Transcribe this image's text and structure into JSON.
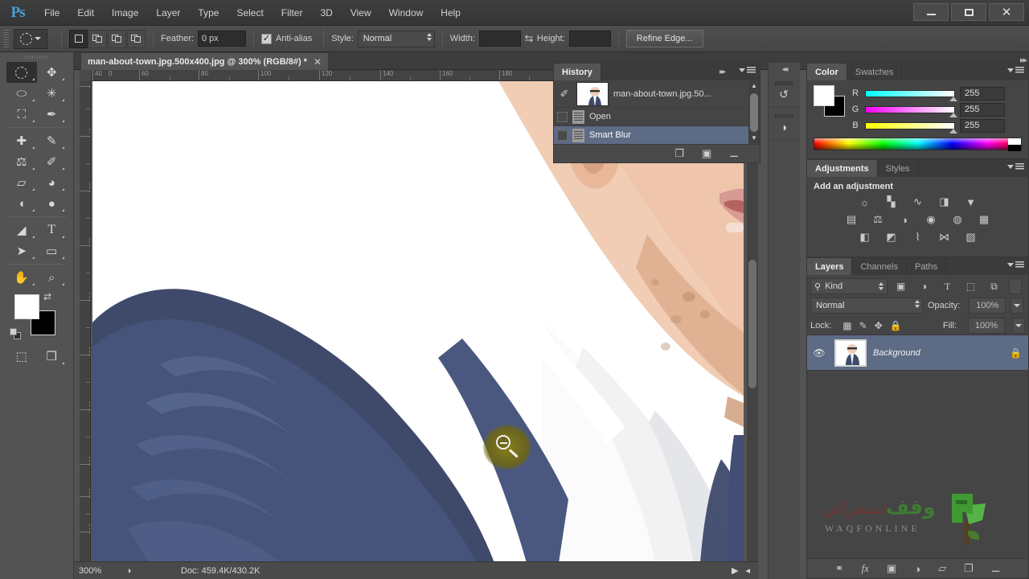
{
  "app": {
    "name": "Ps"
  },
  "menubar": {
    "items": [
      "File",
      "Edit",
      "Image",
      "Layer",
      "Type",
      "Select",
      "Filter",
      "3D",
      "View",
      "Window",
      "Help"
    ],
    "window_controls": {
      "minimize": "minimize-icon",
      "maximize": "maximize-icon",
      "close": "close-icon"
    }
  },
  "options_bar": {
    "tool_preset_icon": "elliptical-marquee-icon",
    "selection_modes": [
      "new-selection",
      "add-to-selection",
      "subtract-from-selection",
      "intersect-with-selection"
    ],
    "feather_label": "Feather:",
    "feather_value": "0 px",
    "antialias_label": "Anti-alias",
    "antialias_checked": true,
    "style_label": "Style:",
    "style_value": "Normal",
    "width_label": "Width:",
    "width_value": "",
    "height_label": "Height:",
    "height_value": "",
    "swap_icon": "swap-width-height-icon",
    "refine_edge_label": "Refine Edge..."
  },
  "toolbar": {
    "tools": [
      {
        "name": "elliptical-marquee-tool",
        "glyph": "◌",
        "active": true
      },
      {
        "name": "move-tool",
        "glyph": "✥",
        "active": false
      },
      {
        "name": "lasso-tool",
        "glyph": "⬭",
        "active": false
      },
      {
        "name": "magic-wand-tool",
        "glyph": "✳",
        "active": false
      },
      {
        "name": "crop-tool",
        "glyph": "⛶",
        "active": false
      },
      {
        "name": "eyedropper-tool",
        "glyph": "✒",
        "active": false
      },
      {
        "name": "spot-healing-brush-tool",
        "glyph": "⊕",
        "active": false
      },
      {
        "name": "brush-tool",
        "glyph": "✎",
        "active": false
      },
      {
        "name": "clone-stamp-tool",
        "glyph": "⚒",
        "active": false
      },
      {
        "name": "history-brush-tool",
        "glyph": "✐",
        "active": false
      },
      {
        "name": "eraser-tool",
        "glyph": "▱",
        "active": false
      },
      {
        "name": "paint-bucket-tool",
        "glyph": "◕",
        "active": false
      },
      {
        "name": "blur-tool",
        "glyph": "◖",
        "active": false
      },
      {
        "name": "dodge-tool",
        "glyph": "●",
        "active": false
      },
      {
        "name": "pen-tool",
        "glyph": "✒",
        "active": false
      },
      {
        "name": "horizontal-type-tool",
        "glyph": "T",
        "active": false
      },
      {
        "name": "path-selection-tool",
        "glyph": "➤",
        "active": false
      },
      {
        "name": "rectangle-tool",
        "glyph": "▭",
        "active": false
      },
      {
        "name": "hand-tool",
        "glyph": "✋",
        "active": false
      },
      {
        "name": "zoom-tool",
        "glyph": "⌕",
        "active": false
      }
    ],
    "foreground_color": "#ffffff",
    "background_color": "#000000",
    "bottom_tools": [
      {
        "name": "quick-mask-mode-button",
        "glyph": "⬚"
      },
      {
        "name": "screen-mode-button",
        "glyph": "❐"
      }
    ]
  },
  "document": {
    "tab_title": "man-about-town.jpg.500x400.jpg @ 300% (RGB/8#) *",
    "tab_close_icon": "close-icon",
    "ruler_h_ticks": [
      "40",
      "0",
      "60",
      "80",
      "100",
      "120",
      "140",
      "160",
      "180"
    ],
    "ruler_v_ticks": [
      "0",
      "140",
      "160",
      "180",
      "200",
      "220",
      "240",
      "260",
      "280",
      "300"
    ],
    "cursor": "zoom-out-cursor"
  },
  "status_bar": {
    "zoom": "300%",
    "preview_icon": "document-preview-icon",
    "doc_info": "Doc: 459.4K/430.2K",
    "play_icon": "play-icon",
    "collapse_icon": "collapse-left-icon"
  },
  "mini_dock": {
    "collapse_icon": "collapse-dock-icon",
    "buttons": [
      {
        "name": "history-actions-dock-button",
        "glyph": "↺"
      },
      {
        "name": "color-swatches-dock-button",
        "glyph": "◑"
      }
    ]
  },
  "history_panel": {
    "tabs": [
      {
        "label": "History",
        "active": true
      }
    ],
    "forward_icon": "fast-forward-icon",
    "menu_icon": "panel-menu-icon",
    "items": [
      {
        "label": "man-about-town.jpg.50...",
        "type": "snapshot",
        "selected": false
      },
      {
        "label": "Open",
        "type": "state",
        "selected": false
      },
      {
        "label": "Smart Blur",
        "type": "state",
        "selected": true
      }
    ],
    "footer_buttons": [
      {
        "name": "create-document-from-state-button",
        "glyph": "❐"
      },
      {
        "name": "create-snapshot-button",
        "glyph": "▣"
      },
      {
        "name": "delete-state-button",
        "glyph": "Ὕ1"
      }
    ]
  },
  "color_panel": {
    "tabs": [
      {
        "label": "Color",
        "active": true
      },
      {
        "label": "Swatches",
        "active": false
      }
    ],
    "menu_icon": "panel-menu-icon",
    "foreground_color": "#ffffff",
    "background_color": "#000000",
    "channels": [
      {
        "label": "R",
        "value": "255"
      },
      {
        "label": "G",
        "value": "255"
      },
      {
        "label": "B",
        "value": "255"
      }
    ]
  },
  "adjustments_panel": {
    "tabs": [
      {
        "label": "Adjustments",
        "active": true
      },
      {
        "label": "Styles",
        "active": false
      }
    ],
    "menu_icon": "panel-menu-icon",
    "title": "Add an adjustment",
    "rows": [
      [
        {
          "name": "brightness-contrast-icon",
          "glyph": "☼"
        },
        {
          "name": "levels-icon",
          "glyph": "☲"
        },
        {
          "name": "curves-icon",
          "glyph": "∿"
        },
        {
          "name": "exposure-icon",
          "glyph": "◨"
        },
        {
          "name": "vibrance-icon",
          "glyph": "▽"
        }
      ],
      [
        {
          "name": "hue-saturation-icon",
          "glyph": "▤"
        },
        {
          "name": "color-balance-icon",
          "glyph": "⚖"
        },
        {
          "name": "black-white-icon",
          "glyph": "◑"
        },
        {
          "name": "photo-filter-icon",
          "glyph": "◌"
        },
        {
          "name": "channel-mixer-icon",
          "glyph": "◕"
        },
        {
          "name": "color-lookup-icon",
          "glyph": "▦"
        }
      ],
      [
        {
          "name": "invert-icon",
          "glyph": "◧"
        },
        {
          "name": "posterize-icon",
          "glyph": "◩"
        },
        {
          "name": "threshold-icon",
          "glyph": "⌇"
        },
        {
          "name": "selective-color-icon",
          "glyph": "⋈"
        },
        {
          "name": "gradient-map-icon",
          "glyph": "▧"
        }
      ]
    ]
  },
  "layers_panel": {
    "tabs": [
      {
        "label": "Layers",
        "active": true
      },
      {
        "label": "Channels",
        "active": false
      },
      {
        "label": "Paths",
        "active": false
      }
    ],
    "menu_icon": "panel-menu-icon",
    "filter": {
      "search_icon": "search-icon",
      "kind_label": "Kind",
      "type_filters": [
        {
          "name": "filter-pixel-layers-icon",
          "glyph": "▣"
        },
        {
          "name": "filter-adjustment-layers-icon",
          "glyph": "◑"
        },
        {
          "name": "filter-type-layers-icon",
          "glyph": "T"
        },
        {
          "name": "filter-shape-layers-icon",
          "glyph": "⬚"
        },
        {
          "name": "filter-smart-objects-icon",
          "glyph": "⧉"
        }
      ],
      "toggle_name": "filter-enable-toggle"
    },
    "blend_mode": "Normal",
    "opacity_label": "Opacity:",
    "opacity_value": "100%",
    "lock_label": "Lock:",
    "lock_buttons": [
      {
        "name": "lock-transparent-pixels-icon",
        "glyph": "⬚"
      },
      {
        "name": "lock-image-pixels-icon",
        "glyph": "✎"
      },
      {
        "name": "lock-position-icon",
        "glyph": "✥"
      },
      {
        "name": "lock-all-icon",
        "glyph": "ὑ2"
      }
    ],
    "fill_label": "Fill:",
    "fill_value": "100%",
    "layers": [
      {
        "name": "Background",
        "visible": true,
        "locked": true,
        "selected": true
      }
    ],
    "footer_buttons": [
      {
        "name": "link-layers-button",
        "glyph": "⚭"
      },
      {
        "name": "layer-style-button",
        "glyph": "ƒx"
      },
      {
        "name": "add-layer-mask-button",
        "glyph": "▣"
      },
      {
        "name": "new-fill-adjustment-layer-button",
        "glyph": "◑"
      },
      {
        "name": "new-group-button",
        "glyph": "▱"
      },
      {
        "name": "new-layer-button",
        "glyph": "❐"
      },
      {
        "name": "delete-layer-button",
        "glyph": "Ὕ1"
      }
    ]
  },
  "watermark": {
    "arabic_red": "استعراض",
    "arabic_green": "وقف",
    "latin": "WAQFONLINE"
  },
  "colors": {
    "chrome": "#535353",
    "panel": "#454545",
    "selection_blue": "#5d6b85",
    "accent_blue": "#4a9fd8",
    "cursor_halo": "#8a8014"
  }
}
